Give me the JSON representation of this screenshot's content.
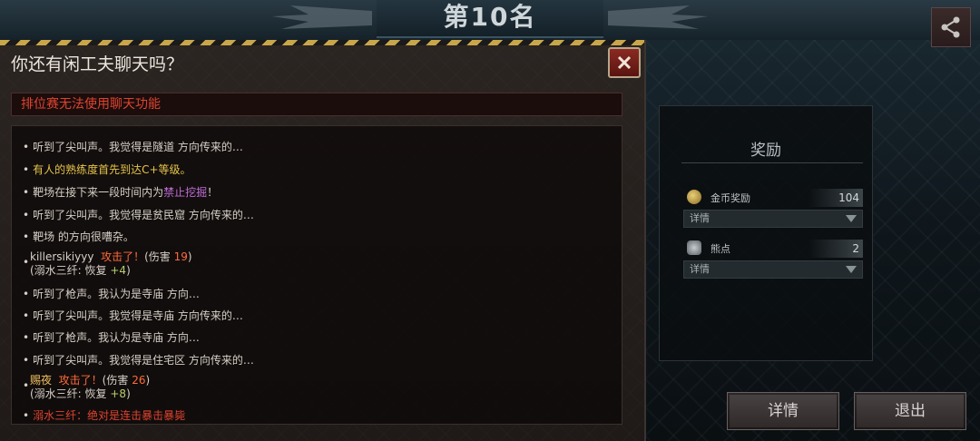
{
  "header": {
    "rank_title": "第10名"
  },
  "dialog": {
    "title": "你还有闲工夫聊天吗？",
    "notice": "排位赛无法使用聊天功能",
    "messages": {
      "m1": "听到了尖叫声。我觉得是隧道 方向传来的…",
      "m2": "有人的熟练度首先到达C+等级。",
      "m3_pre": "靶场在接下来一段时间内为",
      "m3_hl": "禁止挖掘",
      "m3_post": "！",
      "m4": "听到了尖叫声。我觉得是贫民窟 方向传来的…",
      "m5": "靶场 的方向很嘈杂。",
      "m6_name": "killersikiyyy",
      "m6_attack": "攻击了！",
      "m6_dmg_pre": "(伤害",
      "m6_dmg": "19",
      "m6_dmg_post": ")",
      "m6_sub_pre": "(溺水三纤: 恢复",
      "m6_sub_val": "+4",
      "m6_sub_post": ")",
      "m7": "听到了枪声。我认为是寺庙 方向…",
      "m8": "听到了尖叫声。我觉得是寺庙 方向传来的…",
      "m9": "听到了枪声。我认为是寺庙 方向…",
      "m10": "听到了尖叫声。我觉得是住宅区 方向传来的…",
      "m11_name": "赐夜",
      "m11_attack": "攻击了！",
      "m11_dmg_pre": "(伤害",
      "m11_dmg": "26",
      "m11_dmg_post": ")",
      "m11_sub_pre": "(溺水三纤: 恢复",
      "m11_sub_val": "+8",
      "m11_sub_post": ")",
      "m12": "溺水三纤：绝对是连击暴击暴毙"
    }
  },
  "reward": {
    "title": "奖励",
    "gold_label": "金币奖励",
    "gold_value": "104",
    "gold_select": "详情",
    "bear_label": "熊点",
    "bear_value": "2",
    "bear_select": "详情"
  },
  "buttons": {
    "details": "详情",
    "quit": "退出"
  },
  "colors": {
    "notice_red": "#e0432f",
    "accent_yellow": "#e6c44a",
    "hazard": "#c9a64a"
  }
}
